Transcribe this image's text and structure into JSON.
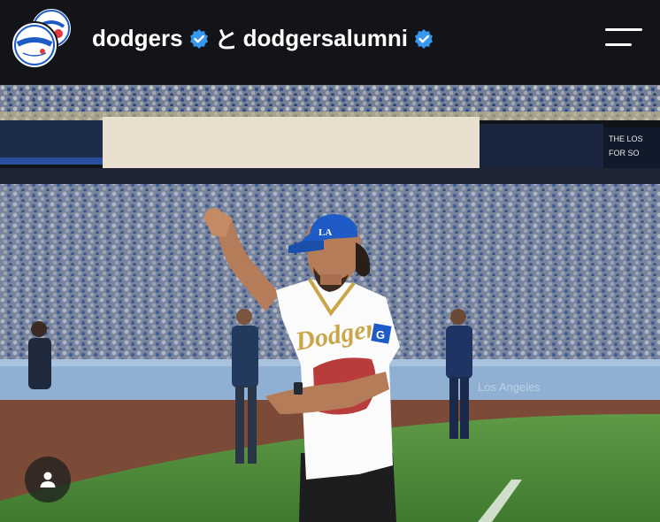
{
  "header": {
    "account_primary": "dodgers",
    "connector": "と",
    "account_secondary": "dodgersalumni",
    "avatar_primary_icon": "dodgers-logo-icon",
    "avatar_secondary_icon": "dodgers-alumni-logo-icon",
    "verified_icon": "verified-badge-icon",
    "verified_color": "#3897f0",
    "menu_icon": "menu-icon"
  },
  "photo": {
    "cap_logo_text": "LA",
    "jersey_script": "Dodgers",
    "sleeve_patch": "G",
    "scoreboard_fragment": "THE LOS\nFOR SO"
  },
  "overlay": {
    "profile_icon": "person-icon"
  },
  "colors": {
    "header_bg": "#121418",
    "dodger_blue": "#1e5bc6",
    "grass": "#4c8a3a",
    "jersey_gold": "#c9a64a"
  }
}
